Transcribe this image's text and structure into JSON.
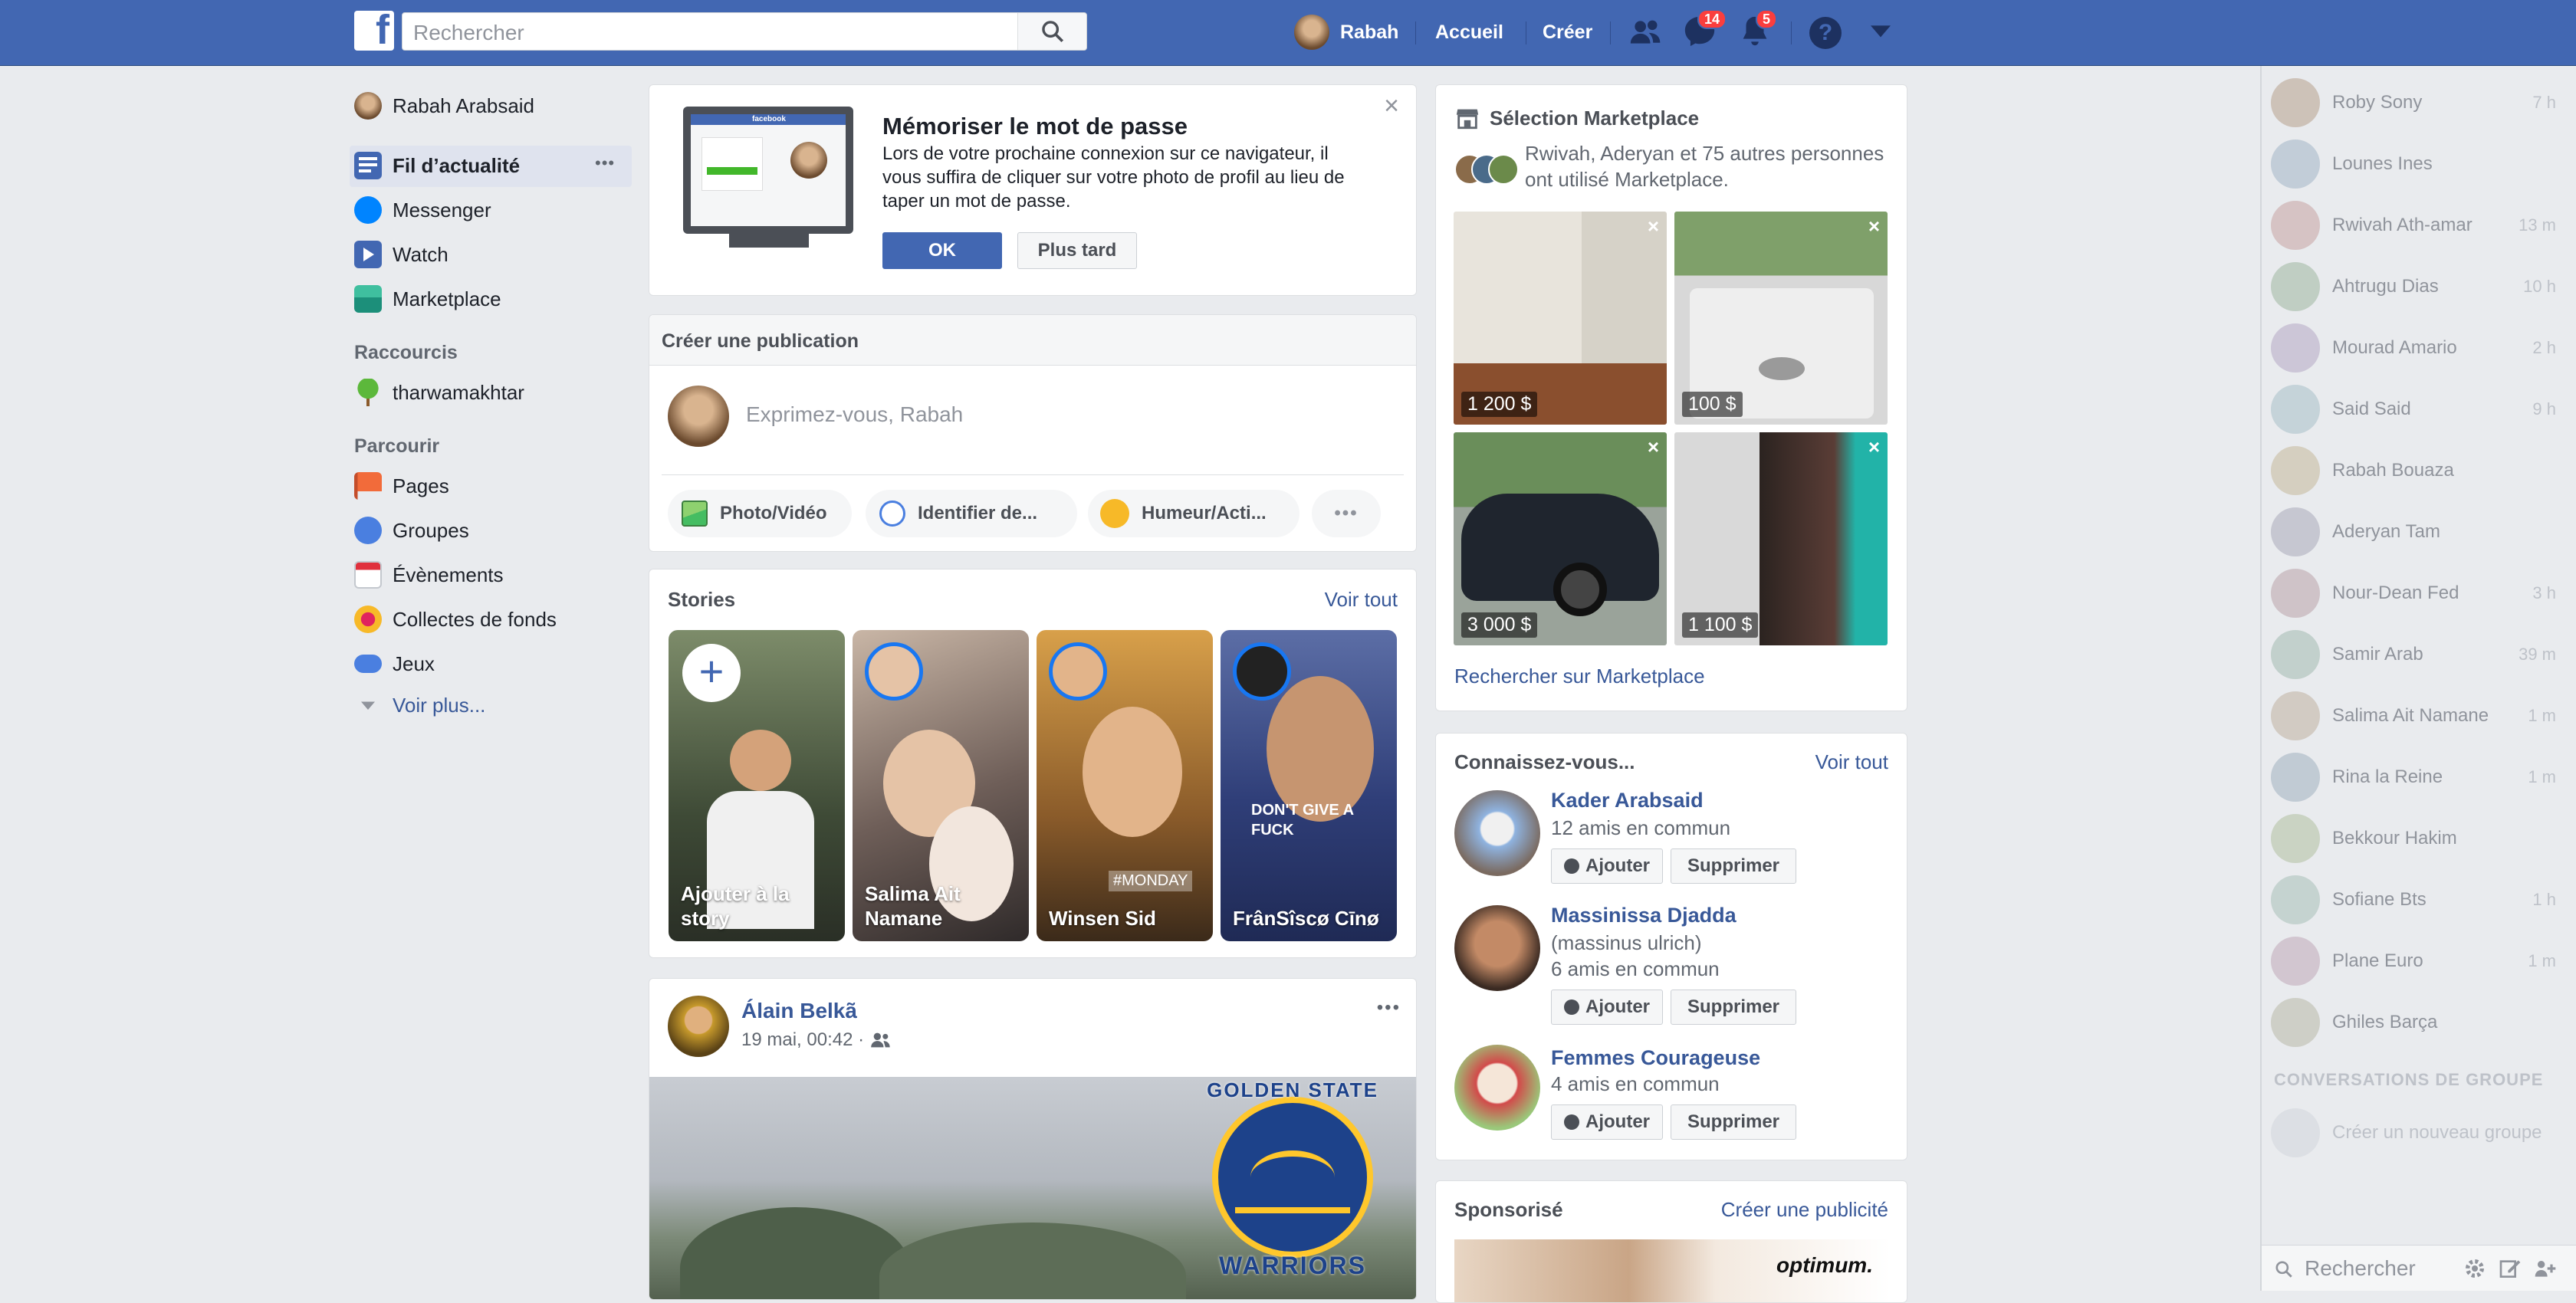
{
  "topbar": {
    "search_placeholder": "Rechercher",
    "user": "Rabah",
    "home": "Accueil",
    "create": "Créer",
    "messages_badge": "14",
    "notifications_badge": "5",
    "help": "?"
  },
  "left_nav": {
    "profile": "Rabah Arabsaid",
    "items": [
      "Fil d’actualité",
      "Messenger",
      "Watch",
      "Marketplace"
    ],
    "shortcuts_title": "Raccourcis",
    "shortcuts": [
      "tharwamakhtar"
    ],
    "explore_title": "Parcourir",
    "explore": [
      "Pages",
      "Groupes",
      "Évènements",
      "Collectes de fonds",
      "Jeux"
    ],
    "see_more": "Voir plus...",
    "more_dots": "•••"
  },
  "password_card": {
    "title": "Mémoriser le mot de passe",
    "body": "Lors de votre prochaine connexion sur ce navigateur, il vous suffira de cliquer sur votre photo de profil au lieu de taper un mot de passe.",
    "ok": "OK",
    "later": "Plus tard",
    "close": "×",
    "laptop_brand": "facebook"
  },
  "composer": {
    "title": "Créer une publication",
    "placeholder": "Exprimez-vous, Rabah",
    "actions": [
      "Photo/Vidéo",
      "Identifier de...",
      "Humeur/Acti..."
    ],
    "more": "•••"
  },
  "stories": {
    "title": "Stories",
    "see_all": "Voir tout",
    "items": [
      "Ajouter à la story",
      "Salima Ait Namane",
      "Winsen Sid",
      "FrânSîscø Cīnø"
    ],
    "add_plus": "+",
    "story4_text": "DON'T GIVE A FUCK",
    "story3_text": "#MONDAY"
  },
  "post": {
    "author": "Álain Belkã",
    "date": "19 mai, 00:42 ·",
    "more": "•••",
    "logo_top": "GOLDEN STATE",
    "logo_bottom": "WARRIORS"
  },
  "marketplace": {
    "title": "Sélection Marketplace",
    "subtitle": "Rwivah, Aderyan et 75 autres personnes ont utilisé Marketplace.",
    "items": [
      {
        "price": "1 200 $"
      },
      {
        "price": "100 $"
      },
      {
        "price": "3 000 $"
      },
      {
        "price": "1 100 $"
      }
    ],
    "close": "×",
    "search_link": "Rechercher sur Marketplace"
  },
  "suggestions": {
    "title": "Connaissez-vous...",
    "see_all": "Voir tout",
    "add": "Ajouter",
    "remove": "Supprimer",
    "people": [
      {
        "name": "Kader Arabsaid",
        "sub1": "12 amis en commun",
        "sub2": ""
      },
      {
        "name": "Massinissa Djadda",
        "sub1": "(massinus ulrich)",
        "sub2": "6 amis en commun"
      },
      {
        "name": "Femmes Courageuse",
        "sub1": "4 amis en commun",
        "sub2": ""
      }
    ]
  },
  "sponsored": {
    "title": "Sponsorisé",
    "link": "Créer une publicité",
    "ad_brand": "optimum."
  },
  "chat": {
    "contacts": [
      {
        "name": "Roby Sony",
        "time": "7 h"
      },
      {
        "name": "Lounes Ines",
        "time": ""
      },
      {
        "name": "Rwivah Ath-amar",
        "time": "13 m"
      },
      {
        "name": "Ahtrugu Dias",
        "time": "10 h"
      },
      {
        "name": "Mourad Amario",
        "time": "2 h"
      },
      {
        "name": "Said Said",
        "time": "9 h"
      },
      {
        "name": "Rabah Bouaza",
        "time": ""
      },
      {
        "name": "Aderyan Tam",
        "time": ""
      },
      {
        "name": "Nour-Dean Fed",
        "time": "3 h"
      },
      {
        "name": "Samir Arab",
        "time": "39 m"
      },
      {
        "name": "Salima Ait Namane",
        "time": "1 m"
      },
      {
        "name": "Rina la Reine",
        "time": "1 m"
      },
      {
        "name": "Bekkour Hakim",
        "time": ""
      },
      {
        "name": "Sofiane Bts",
        "time": "1 h"
      },
      {
        "name": "Plane Euro",
        "time": "1 m"
      },
      {
        "name": "Ghiles Barça",
        "time": ""
      }
    ],
    "group_title": "CONVERSATIONS DE GROUPE",
    "new_group": "Créer un nouveau groupe",
    "search_placeholder": "Rechercher"
  }
}
